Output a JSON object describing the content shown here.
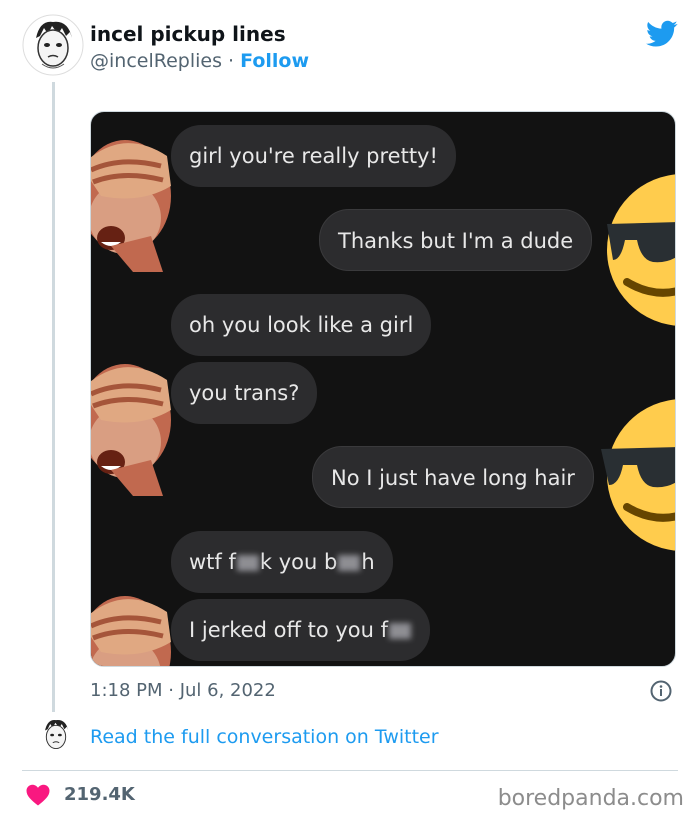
{
  "tweet": {
    "display_name": "incel pickup lines",
    "handle": "@incelReplies",
    "separator": "·",
    "follow_label": "Follow",
    "timestamp": "1:18 PM · Jul 6, 2022",
    "read_more": "Read the full conversation on Twitter",
    "likes": "219.4K"
  },
  "conversation": {
    "messages": [
      {
        "side": "left",
        "text": "girl you're really pretty!"
      },
      {
        "side": "right",
        "text": "Thanks but I'm a dude"
      },
      {
        "side": "left",
        "text": "oh you look like a girl"
      },
      {
        "side": "left",
        "text": "you trans?"
      },
      {
        "side": "right",
        "text": "No I just have long hair"
      },
      {
        "side": "left",
        "text_a": "wtf f",
        "text_b": "k you b",
        "text_c": "h"
      },
      {
        "side": "left",
        "text_a": "I jerked off to you f"
      }
    ]
  },
  "watermark": "boredpanda.com",
  "colors": {
    "twitter_blue": "#1d9bf0",
    "heart": "#f91880",
    "chat_bg": "#121212",
    "bubble": "#2c2c2e"
  },
  "icons": [
    "twitter-bird-icon",
    "info-icon",
    "heart-icon",
    "see-no-evil-monkey-emoji",
    "sunglasses-face-emoji"
  ]
}
